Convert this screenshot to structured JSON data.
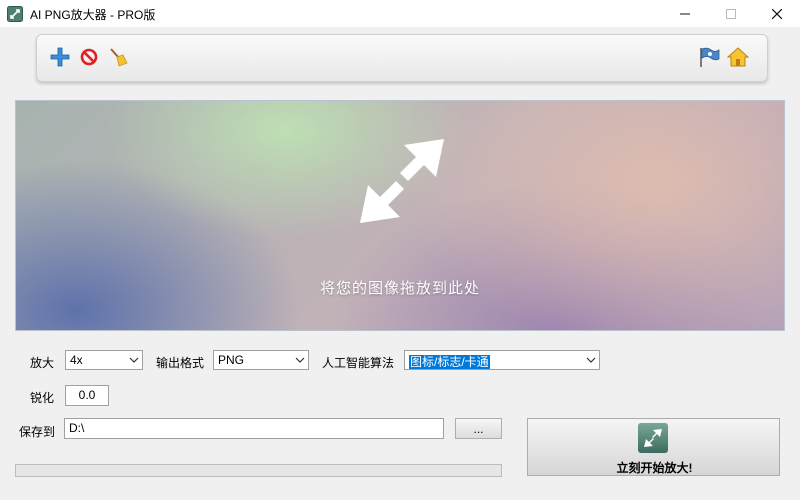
{
  "window": {
    "title": "AI PNG放大器 - PRO版"
  },
  "toolbar": {
    "left_icons": [
      "add-icon",
      "delete-icon",
      "clear-icon"
    ],
    "right_icons": [
      "flag-icon",
      "home-icon"
    ]
  },
  "drop_zone": {
    "text": "将您的图像拖放到此处"
  },
  "options": {
    "scale_label": "放大",
    "scale_value": "4x",
    "format_label": "输出格式",
    "format_value": "PNG",
    "algorithm_label": "人工智能算法",
    "algorithm_value": "图标/标志/卡通",
    "sharpen_label": "锐化",
    "sharpen_value": "0.0",
    "save_label": "保存到",
    "save_path": "D:\\",
    "browse_label": "..."
  },
  "start": {
    "label": "立刻开始放大!"
  },
  "progress": {
    "value": 0
  }
}
